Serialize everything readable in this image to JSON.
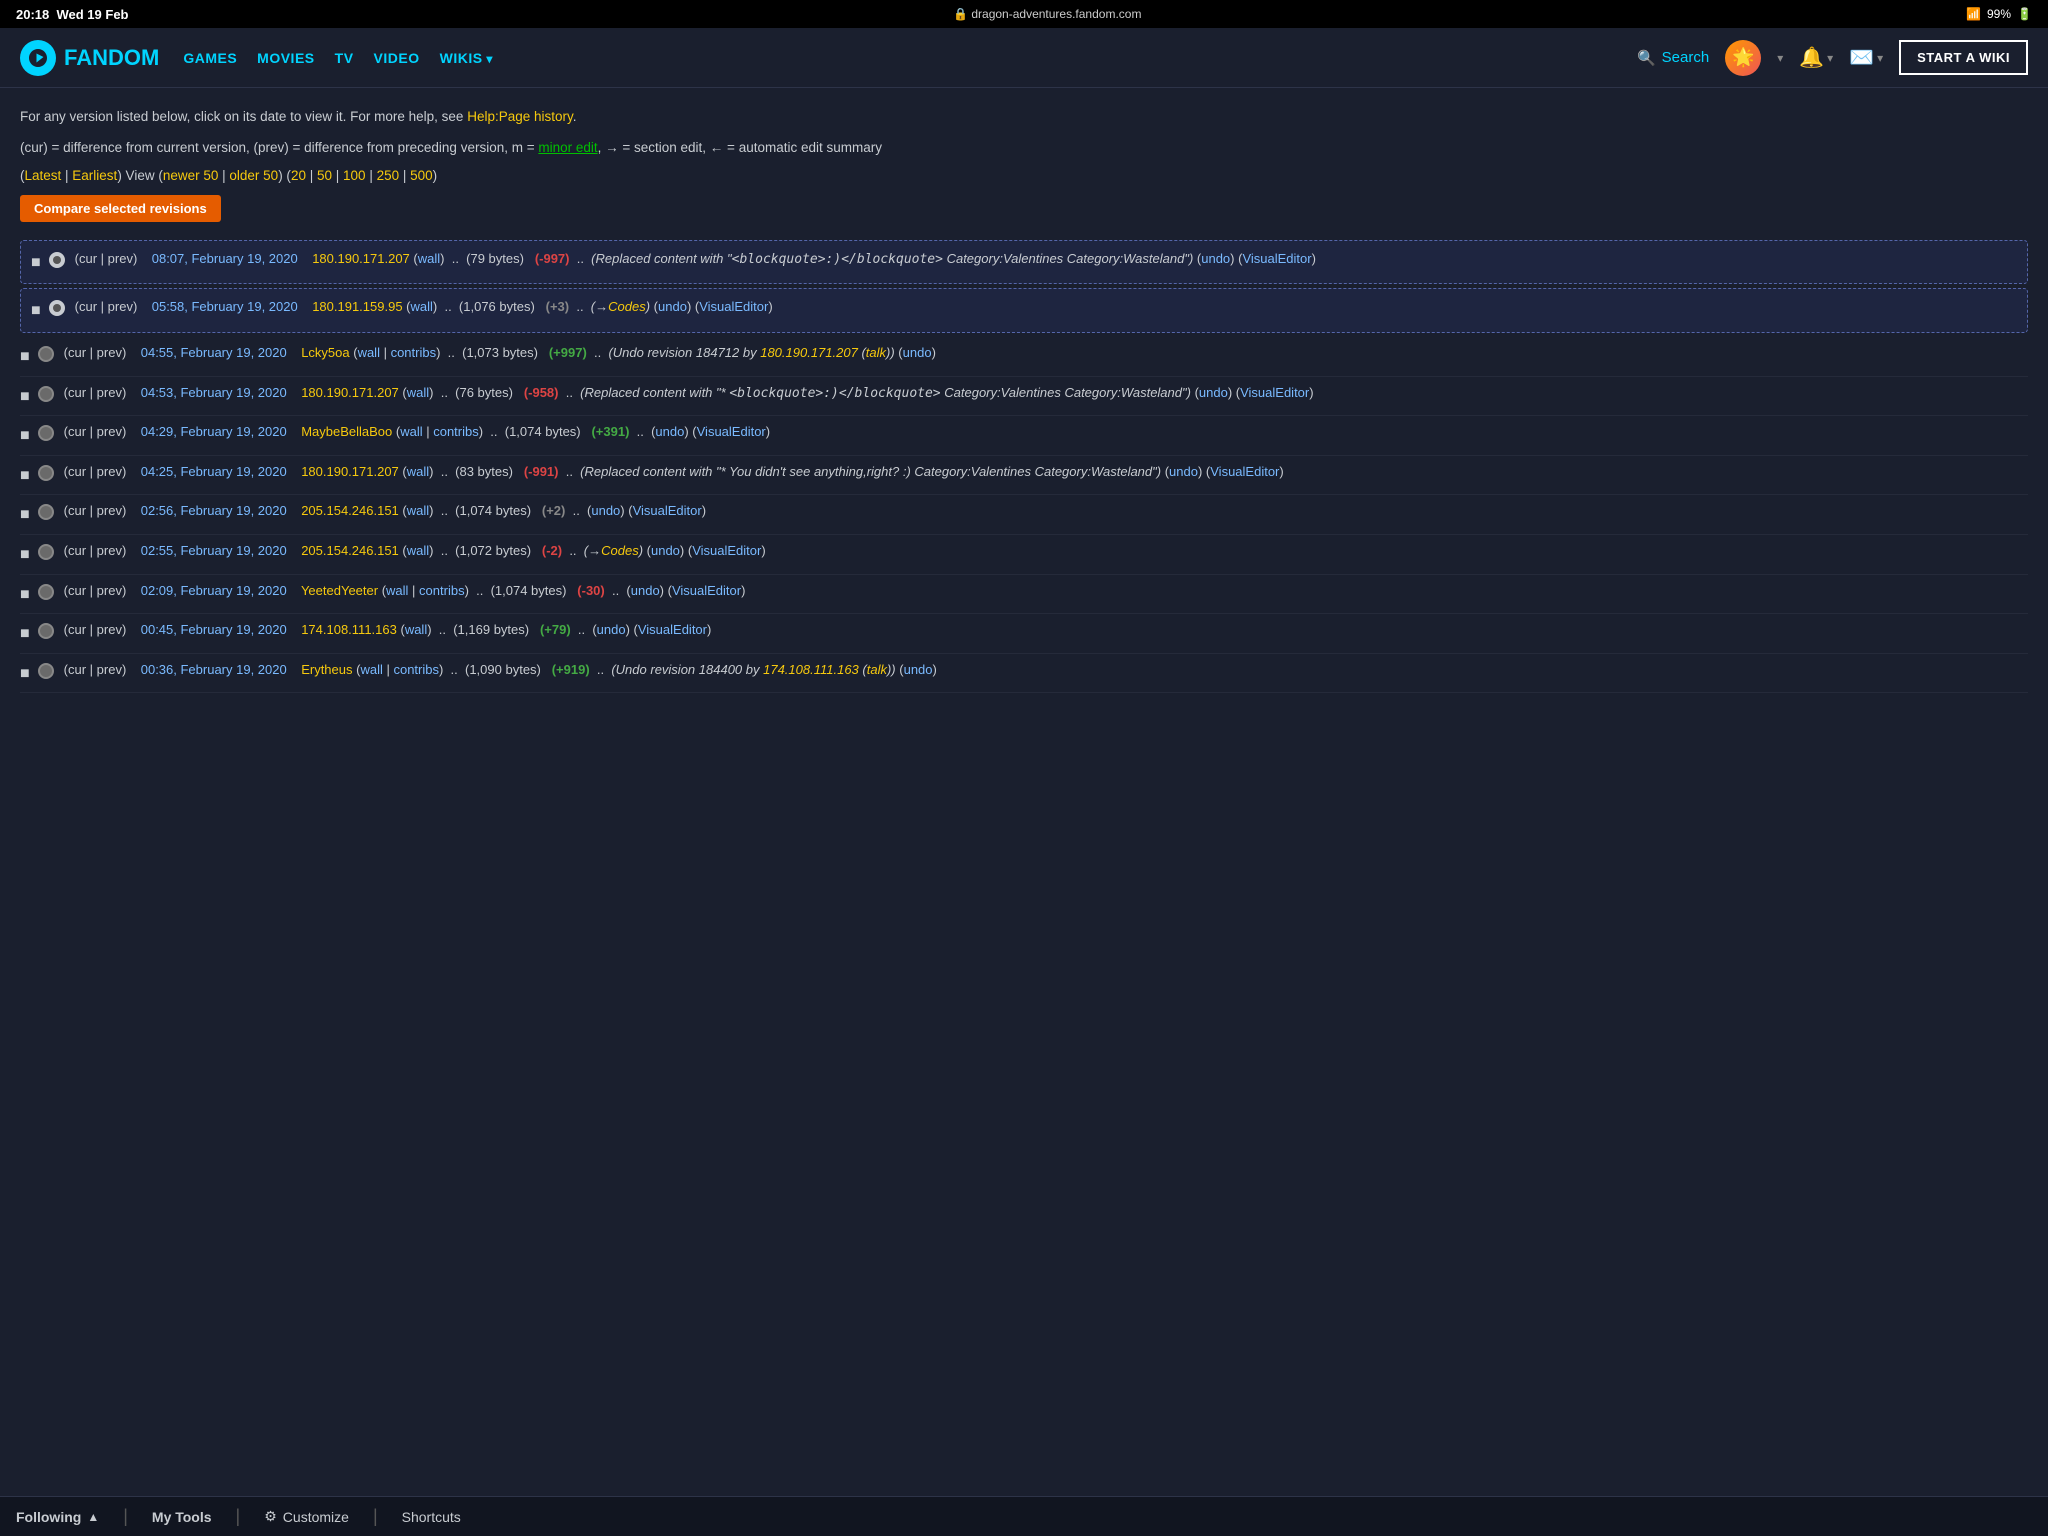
{
  "statusBar": {
    "time": "20:18",
    "day": "Wed 19 Feb",
    "url": "dragon-adventures.fandom.com",
    "wifi": "wifi",
    "battery": "99%"
  },
  "nav": {
    "logo": "FANDOM",
    "links": [
      {
        "label": "GAMES",
        "hasArrow": false
      },
      {
        "label": "MOVIES",
        "hasArrow": false
      },
      {
        "label": "TV",
        "hasArrow": false
      },
      {
        "label": "VIDEO",
        "hasArrow": false
      },
      {
        "label": "WIKIS",
        "hasArrow": true
      }
    ],
    "search": "Search",
    "startWiki": "START A WIKI"
  },
  "info": {
    "line1": "For any version listed below, click on its date to view it. For more help, see ",
    "helpLink": "Help:Page history",
    "line1end": ".",
    "line2start": "(cur) = difference from current version, (prev) = difference from preceding version, m = ",
    "minorEdit": "minor edit",
    "line2end": ", → = section edit, ← = automatic edit summary",
    "viewLine": "(Latest | Earliest) View (newer 50 | older 50) (20 | 50 | 100 | 250 | 500)",
    "compareBtn": "Compare selected revisions"
  },
  "revisions": [
    {
      "id": 1,
      "highlighted": true,
      "radioSelected": true,
      "curPrev": "(cur | prev)",
      "date": "08:07, February 19, 2020",
      "ip": "180.190.171.207",
      "wallLink": "wall",
      "bytes": "(79 bytes)",
      "delta": "(-997)",
      "deltaType": "neg",
      "comment": "(Replaced content with \"<blockquote>:)</blockquote> Category:Valentines Category:Wasteland\") (undo) (VisualEditor)"
    },
    {
      "id": 2,
      "highlighted": true,
      "radioSelected": true,
      "curPrev": "(cur | prev)",
      "date": "05:58, February 19, 2020",
      "ip": "180.191.159.95",
      "wallLink": "wall",
      "bytes": "(1,076 bytes)",
      "delta": "(+3)",
      "deltaType": "small",
      "comment": "(→Codes) (undo) (VisualEditor)"
    },
    {
      "id": 3,
      "highlighted": false,
      "curPrev": "(cur | prev)",
      "date": "04:55, February 19, 2020",
      "user": "Lcky5oa",
      "wallLink": "wall",
      "contribs": "contribs",
      "bytes": "(1,073 bytes)",
      "delta": "(+997)",
      "deltaType": "pos",
      "comment": "(Undo revision 184712 by 180.190.171.207 (talk)) (undo)"
    },
    {
      "id": 4,
      "highlighted": false,
      "curPrev": "(cur | prev)",
      "date": "04:53, February 19, 2020",
      "ip": "180.190.171.207",
      "wallLink": "wall",
      "bytes": "(76 bytes)",
      "delta": "(-958)",
      "deltaType": "neg",
      "comment": "(Replaced content with \"* <blockquote>:)</blockquote> Category:Valentines Category:Wasteland\") (undo) (VisualEditor)"
    },
    {
      "id": 5,
      "highlighted": false,
      "curPrev": "(cur | prev)",
      "date": "04:29, February 19, 2020",
      "user": "MaybeBellaBoo",
      "wallLink": "wall",
      "contribs": "contribs",
      "bytes": "(1,074 bytes)",
      "delta": "(+391)",
      "deltaType": "pos",
      "comment": "(undo) (VisualEditor)"
    },
    {
      "id": 6,
      "highlighted": false,
      "curPrev": "(cur | prev)",
      "date": "04:25, February 19, 2020",
      "ip": "180.190.171.207",
      "wallLink": "wall",
      "bytes": "(83 bytes)",
      "delta": "(-991)",
      "deltaType": "neg",
      "comment": "(Replaced content with \"* You didn't see anything,right? :) Category:Valentines Category:Wasteland\") (undo) (VisualEditor)"
    },
    {
      "id": 7,
      "highlighted": false,
      "curPrev": "(cur | prev)",
      "date": "02:56, February 19, 2020",
      "ip": "205.154.246.151",
      "wallLink": "wall",
      "bytes": "(1,074 bytes)",
      "delta": "(+2)",
      "deltaType": "small",
      "comment": "(undo) (VisualEditor)"
    },
    {
      "id": 8,
      "highlighted": false,
      "curPrev": "(cur | prev)",
      "date": "02:55, February 19, 2020",
      "ip": "205.154.246.151",
      "wallLink": "wall",
      "bytes": "(1,072 bytes)",
      "delta": "(-2)",
      "deltaType": "neg-small",
      "comment": "(→Codes) (undo) (VisualEditor)"
    },
    {
      "id": 9,
      "highlighted": false,
      "curPrev": "(cur | prev)",
      "date": "02:09, February 19, 2020",
      "user": "YeetedYeeter",
      "wallLink": "wall",
      "contribs": "contribs",
      "bytes": "(1,074 bytes)",
      "delta": "(-30)",
      "deltaType": "neg-small",
      "comment": "(undo) (VisualEditor)"
    },
    {
      "id": 10,
      "highlighted": false,
      "curPrev": "(cur | prev)",
      "date": "00:45, February 19, 2020",
      "ip": "174.108.111.163",
      "wallLink": "wall",
      "bytes": "(1,169 bytes)",
      "delta": "(+79)",
      "deltaType": "pos",
      "comment": "(undo) (VisualEditor)"
    },
    {
      "id": 11,
      "highlighted": false,
      "curPrev": "(cur | prev)",
      "date": "00:36, February 19, 2020",
      "user": "Erytheus",
      "wallLink": "wall",
      "contribs": "contribs",
      "bytes": "(1,090 bytes)",
      "delta": "(+919)",
      "deltaType": "pos",
      "comment": "(Undo revision 184400 by 174.108.111.163 (talk)) (undo)"
    }
  ],
  "bottomBar": {
    "following": "Following",
    "myTools": "My Tools",
    "customize": "Customize",
    "shortcuts": "Shortcuts"
  }
}
